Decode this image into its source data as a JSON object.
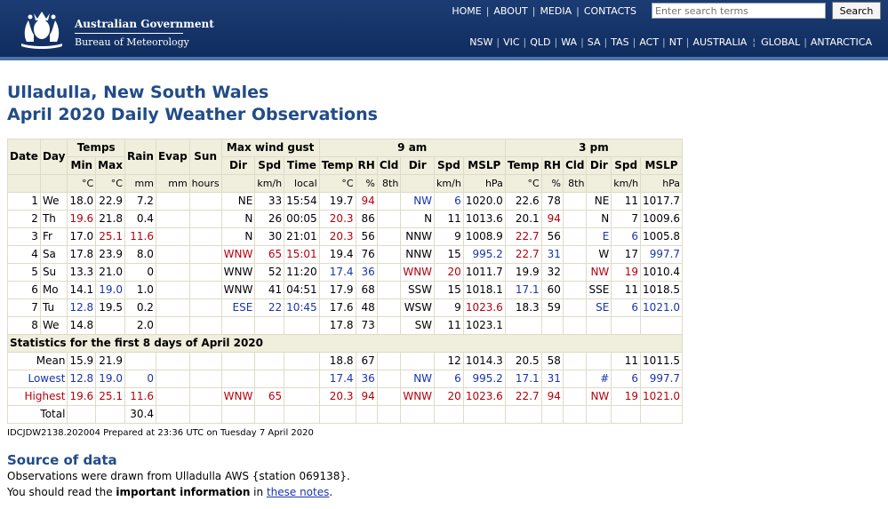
{
  "header": {
    "gov_name": "Australian Government",
    "bom_name": "Bureau of Meteorology",
    "top_links": [
      "HOME",
      "ABOUT",
      "MEDIA",
      "CONTACTS"
    ],
    "search_placeholder": "Enter search terms",
    "search_button": "Search",
    "state_links": [
      "NSW",
      "VIC",
      "QLD",
      "WA",
      "SA",
      "TAS",
      "ACT",
      "NT",
      "AUSTRALIA"
    ],
    "extra_links": [
      "GLOBAL",
      "ANTARCTICA"
    ]
  },
  "title": {
    "line1": "Ulladulla, New South Wales",
    "line2": "April 2020 Daily Weather Observations"
  },
  "table": {
    "group_headers": {
      "temps": "Temps",
      "max_wind_gust": "Max wind gust",
      "am": "9 am",
      "pm": "3 pm"
    },
    "col_headers": {
      "date": "Date",
      "day": "Day",
      "min": "Min",
      "max": "Max",
      "rain": "Rain",
      "evap": "Evap",
      "sun": "Sun",
      "dir": "Dir",
      "spd": "Spd",
      "time": "Time",
      "temp": "Temp",
      "rh": "RH",
      "cld": "Cld",
      "mslp": "MSLP"
    },
    "units": {
      "c": "°C",
      "mm": "mm",
      "hours": "hours",
      "kmh": "km/h",
      "local": "local",
      "pct": "%",
      "eighths": "8th",
      "hpa": "hPa"
    },
    "rows": [
      {
        "date": "1",
        "day": "We",
        "min": "18.0",
        "max": "22.9",
        "rain": "7.2",
        "evap": "",
        "sun": "",
        "gdir": "NE",
        "gspd": "33",
        "gtime": "15:54",
        "t9": "19.7",
        "rh9": "94",
        "cld9": "",
        "dir9": "NW",
        "spd9": "6",
        "p9": "1020.0",
        "t3": "22.6",
        "rh3": "78",
        "cld3": "",
        "dir3": "NE",
        "spd3": "11",
        "p3": "1017.7"
      },
      {
        "date": "2",
        "day": "Th",
        "min": "19.6",
        "max": "21.8",
        "rain": "0.4",
        "evap": "",
        "sun": "",
        "gdir": "N",
        "gspd": "26",
        "gtime": "00:05",
        "t9": "20.3",
        "rh9": "86",
        "cld9": "",
        "dir9": "N",
        "spd9": "11",
        "p9": "1013.6",
        "t3": "20.1",
        "rh3": "94",
        "cld3": "",
        "dir3": "N",
        "spd3": "7",
        "p3": "1009.6"
      },
      {
        "date": "3",
        "day": "Fr",
        "min": "17.0",
        "max": "25.1",
        "rain": "11.6",
        "evap": "",
        "sun": "",
        "gdir": "N",
        "gspd": "30",
        "gtime": "21:01",
        "t9": "20.3",
        "rh9": "56",
        "cld9": "",
        "dir9": "NNW",
        "spd9": "9",
        "p9": "1008.9",
        "t3": "22.7",
        "rh3": "56",
        "cld3": "",
        "dir3": "E",
        "spd3": "6",
        "p3": "1005.8"
      },
      {
        "date": "4",
        "day": "Sa",
        "min": "17.8",
        "max": "23.9",
        "rain": "8.0",
        "evap": "",
        "sun": "",
        "gdir": "WNW",
        "gspd": "65",
        "gtime": "15:01",
        "t9": "19.4",
        "rh9": "76",
        "cld9": "",
        "dir9": "NNW",
        "spd9": "15",
        "p9": "995.2",
        "t3": "22.7",
        "rh3": "31",
        "cld3": "",
        "dir3": "W",
        "spd3": "17",
        "p3": "997.7"
      },
      {
        "date": "5",
        "day": "Su",
        "min": "13.3",
        "max": "21.0",
        "rain": "0",
        "evap": "",
        "sun": "",
        "gdir": "WNW",
        "gspd": "52",
        "gtime": "11:20",
        "t9": "17.4",
        "rh9": "36",
        "cld9": "",
        "dir9": "WNW",
        "spd9": "20",
        "p9": "1011.7",
        "t3": "19.9",
        "rh3": "32",
        "cld3": "",
        "dir3": "NW",
        "spd3": "19",
        "p3": "1010.4"
      },
      {
        "date": "6",
        "day": "Mo",
        "min": "14.1",
        "max": "19.0",
        "rain": "1.0",
        "evap": "",
        "sun": "",
        "gdir": "WNW",
        "gspd": "41",
        "gtime": "04:51",
        "t9": "17.9",
        "rh9": "68",
        "cld9": "",
        "dir9": "SSW",
        "spd9": "15",
        "p9": "1018.1",
        "t3": "17.1",
        "rh3": "60",
        "cld3": "",
        "dir3": "SSE",
        "spd3": "11",
        "p3": "1018.5"
      },
      {
        "date": "7",
        "day": "Tu",
        "min": "12.8",
        "max": "19.5",
        "rain": "0.2",
        "evap": "",
        "sun": "",
        "gdir": "ESE",
        "gspd": "22",
        "gtime": "10:45",
        "t9": "17.6",
        "rh9": "48",
        "cld9": "",
        "dir9": "WSW",
        "spd9": "9",
        "p9": "1023.6",
        "t3": "18.3",
        "rh3": "59",
        "cld3": "",
        "dir3": "SE",
        "spd3": "6",
        "p3": "1021.0"
      },
      {
        "date": "8",
        "day": "We",
        "min": "14.8",
        "max": "",
        "rain": "2.0",
        "evap": "",
        "sun": "",
        "gdir": "",
        "gspd": "",
        "gtime": "",
        "t9": "17.8",
        "rh9": "73",
        "cld9": "",
        "dir9": "SW",
        "spd9": "11",
        "p9": "1023.1",
        "t3": "",
        "rh3": "",
        "cld3": "",
        "dir3": "",
        "spd3": "",
        "p3": ""
      }
    ],
    "stats_title": "Statistics for the first 8 days of April 2020",
    "stats": [
      {
        "label": "Mean",
        "min": "15.9",
        "max": "21.9",
        "rain": "",
        "gdir": "",
        "gspd": "",
        "t9": "18.8",
        "rh9": "67",
        "dir9": "",
        "spd9": "12",
        "p9": "1014.3",
        "t3": "20.5",
        "rh3": "58",
        "dir3": "",
        "spd3": "11",
        "p3": "1011.5"
      },
      {
        "label": "Lowest",
        "min": "12.8",
        "max": "19.0",
        "rain": "0",
        "gdir": "",
        "gspd": "",
        "t9": "17.4",
        "rh9": "36",
        "dir9": "NW",
        "spd9": "6",
        "p9": "995.2",
        "t3": "17.1",
        "rh3": "31",
        "dir3": "#",
        "spd3": "6",
        "p3": "997.7"
      },
      {
        "label": "Highest",
        "min": "19.6",
        "max": "25.1",
        "rain": "11.6",
        "gdir": "WNW",
        "gspd": "65",
        "t9": "20.3",
        "rh9": "94",
        "dir9": "WNW",
        "spd9": "20",
        "p9": "1023.6",
        "t3": "22.7",
        "rh3": "94",
        "dir3": "NW",
        "spd3": "19",
        "p3": "1021.0"
      },
      {
        "label": "Total",
        "min": "",
        "max": "",
        "rain": "30.4",
        "gdir": "",
        "gspd": "",
        "t9": "",
        "rh9": "",
        "dir9": "",
        "spd9": "",
        "p9": "",
        "t3": "",
        "rh3": "",
        "dir3": "",
        "spd3": "",
        "p3": ""
      }
    ]
  },
  "prepared": "IDCJDW2138.202004   Prepared at 23:36 UTC on Tuesday 7 April 2020",
  "source": {
    "title": "Source of data",
    "line1": "Observations were drawn from Ulladulla AWS {station 069138}.",
    "line2_pre": "You should read the ",
    "line2_bold": "important information",
    "line2_mid": " in ",
    "line2_link": "these notes",
    "line2_post": "."
  },
  "colors": {
    "header": "#153367",
    "title": "#214c87",
    "high": "#b5000f",
    "low": "#1a34a8",
    "table_head": "#f0eedd"
  }
}
